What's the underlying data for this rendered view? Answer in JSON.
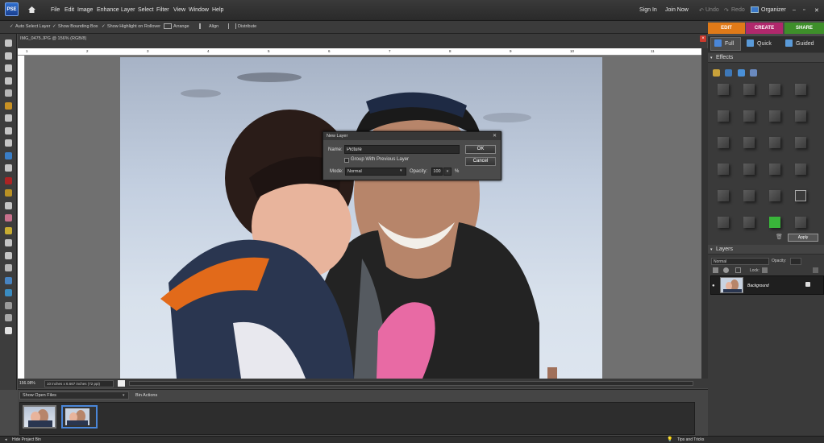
{
  "app": {
    "logo": "PSE"
  },
  "menu": [
    "File",
    "Edit",
    "Image",
    "Enhance",
    "Layer",
    "Select",
    "Filter",
    "View",
    "Window",
    "Help"
  ],
  "top_right": {
    "sign_in": "Sign In",
    "join_now": "Join Now",
    "undo": "Undo",
    "redo": "Redo",
    "organizer": "Organizer"
  },
  "options_bar": {
    "auto_select": "Auto Select Layer",
    "bounding_box": "Show Bounding Box",
    "highlight": "Show Highlight on Rollover",
    "arrange": "Arrange",
    "align": "Align",
    "distribute": "Distribute"
  },
  "mode_tabs": [
    {
      "label": "EDIT",
      "color": "#e07a18"
    },
    {
      "label": "CREATE",
      "color": "#b0286c"
    },
    {
      "label": "SHARE",
      "color": "#3e8f2a"
    }
  ],
  "view_tabs": [
    "Full",
    "Quick",
    "Guided"
  ],
  "document": {
    "title": "IMG_0475.JPG @ 156% (RGB/8)",
    "zoom": "156.08%",
    "size": "10 inches x 6.667 inches (72 ppi)"
  },
  "ruler_numbers": [
    "1",
    "2",
    "3",
    "4",
    "5",
    "6",
    "7",
    "8",
    "9",
    "10",
    "11"
  ],
  "bin": {
    "select": "Show Open Files",
    "actions": "Bin Actions"
  },
  "bottom": {
    "hide_bin": "Hide Project Bin",
    "tips": "Tips and Tricks"
  },
  "effects_panel": {
    "title": "Effects",
    "apply": "Apply"
  },
  "layers_panel": {
    "title": "Layers",
    "blend": "Normal",
    "opacity_label": "Opacity:",
    "lock_label": "Lock:",
    "layer_name": "Background"
  },
  "dialog": {
    "title": "New Layer",
    "name_label": "Name:",
    "name_value": "Picture",
    "group_label": "Group With Previous Layer",
    "mode_label": "Mode:",
    "mode_value": "Normal",
    "opacity_label": "Opacity:",
    "opacity_value": "100",
    "percent": "%",
    "ok": "OK",
    "cancel": "Cancel"
  }
}
